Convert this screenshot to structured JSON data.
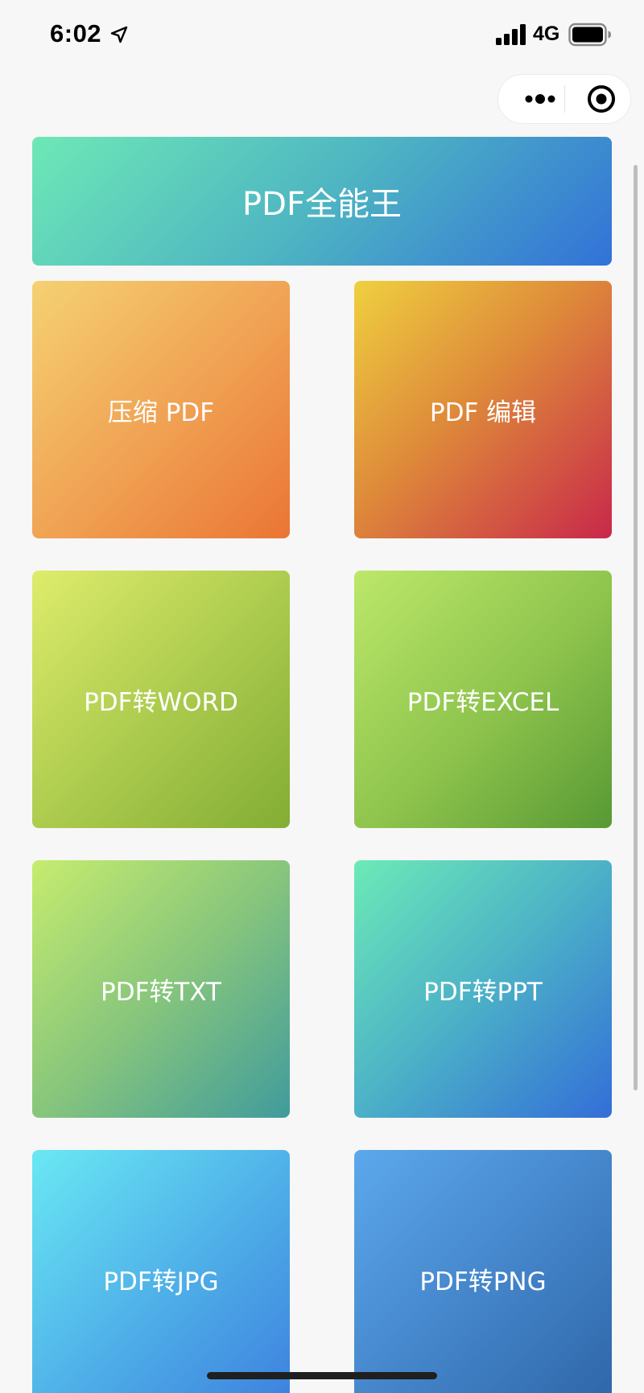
{
  "status_bar": {
    "time": "6:02",
    "network": "4G",
    "icons": [
      "location-arrow-icon",
      "signal-icon",
      "battery-icon"
    ]
  },
  "capsule": {
    "icons": [
      "more-dots-icon",
      "close-target-icon"
    ]
  },
  "banner": {
    "title": "PDF全能王",
    "colors": [
      "#6ee8b6",
      "#3272d8"
    ]
  },
  "tiles": [
    {
      "label": "压缩 PDF",
      "colors": [
        "#f5d173",
        "#ea7534"
      ]
    },
    {
      "label": "PDF 编辑",
      "colors": [
        "#efd03f",
        "#c8284a"
      ]
    },
    {
      "label": "PDF转WORD",
      "colors": [
        "#dfec6c",
        "#83ad34"
      ]
    },
    {
      "label": "PDF转EXCEL",
      "colors": [
        "#bce86a",
        "#589934"
      ]
    },
    {
      "label": "PDF转TXT",
      "colors": [
        "#c6ec6e",
        "#3f9b9c"
      ]
    },
    {
      "label": "PDF转PPT",
      "colors": [
        "#6ceab6",
        "#336ed8"
      ]
    },
    {
      "label": "PDF转JPG",
      "colors": [
        "#6ae8f4",
        "#3d80de"
      ]
    },
    {
      "label": "PDF转PNG",
      "colors": [
        "#5ca8ec",
        "#2e66a8"
      ]
    }
  ]
}
